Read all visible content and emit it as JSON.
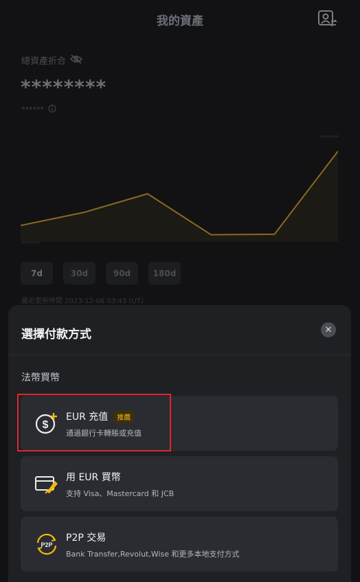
{
  "header": {
    "title": "我的資產",
    "profile_icon": "profile-switch-icon"
  },
  "overview": {
    "total_label": "總資產折合",
    "hide_icon": "eye-off-icon",
    "balance_masked": "********",
    "sub_masked": "******",
    "info_icon": "info-icon"
  },
  "chart_data": {
    "type": "line",
    "values": [
      1.0,
      2.2,
      3.9,
      0.15,
      0.2,
      7.8
    ],
    "y_top_label": "******",
    "y_bottom_label": "******",
    "colors": {
      "line": "#8a6a1e",
      "fill": "#1c1a15"
    }
  },
  "range_tabs": [
    {
      "label": "7d",
      "active": true
    },
    {
      "label": "30d",
      "active": false
    },
    {
      "label": "90d",
      "active": false
    },
    {
      "label": "180d",
      "active": false
    }
  ],
  "update_line": "最近更新時間  2023-12-06 03:43 (UT)",
  "sheet": {
    "title": "選擇付款方式",
    "close_icon": "close-icon",
    "section_label": "法幣買幣",
    "options": [
      {
        "title": "EUR 充值",
        "badge": "推薦",
        "desc": "通過銀行卡轉賬或充值",
        "icon": "dollar-plus-icon"
      },
      {
        "title": "用 EUR 買幣",
        "badge": "",
        "desc": "支持 Visa、Mastercard 和 JCB",
        "icon": "card-rocket-icon"
      },
      {
        "title": "P2P 交易",
        "badge": "",
        "desc": "Bank Transfer,Revolut,Wise 和更多本地支付方式",
        "icon": "p2p-icon"
      }
    ]
  },
  "theme": {
    "accent": "#f0b90b",
    "highlight": "#e3262f"
  }
}
